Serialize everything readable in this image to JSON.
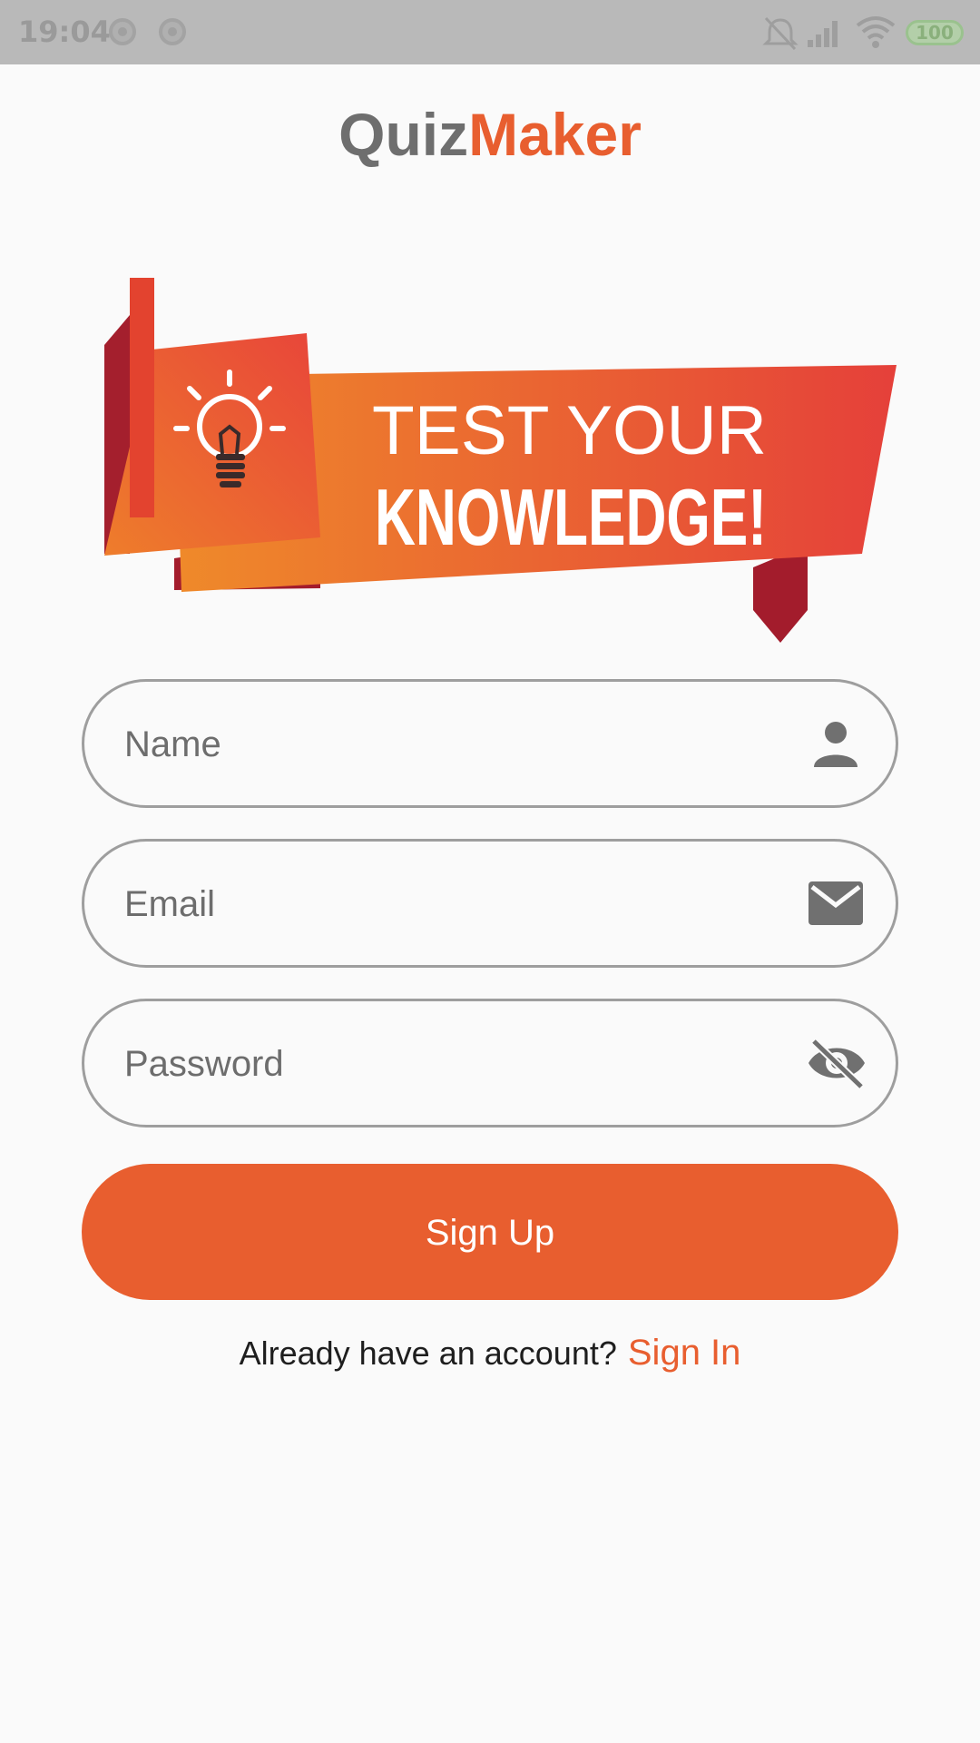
{
  "status_bar": {
    "time": "19:04",
    "battery": "100",
    "icons": [
      "notification-dot-icon",
      "notification-dot-icon",
      "alarm-off-icon",
      "signal-icon",
      "wifi-icon",
      "battery-icon"
    ]
  },
  "app": {
    "title_part1": "Quiz",
    "title_part2": "Maker"
  },
  "banner": {
    "line1": "TEST YOUR",
    "line2": "KNOWLEDGE!",
    "icon": "lightbulb-icon",
    "colors": {
      "orange": "#ec7a2c",
      "red": "#e74a35",
      "dark_red": "#a11f2a"
    }
  },
  "form": {
    "name_placeholder": "Name",
    "name_icon": "person-icon",
    "email_placeholder": "Email",
    "email_icon": "mail-icon",
    "password_placeholder": "Password",
    "password_icon": "visibility-off-icon",
    "signup_label": "Sign Up"
  },
  "footer": {
    "prompt": "Already have an account?",
    "signin_label": "Sign In"
  },
  "colors": {
    "accent": "#e85e2f",
    "title_gray": "#6e6e6e",
    "background": "#fafafa"
  }
}
